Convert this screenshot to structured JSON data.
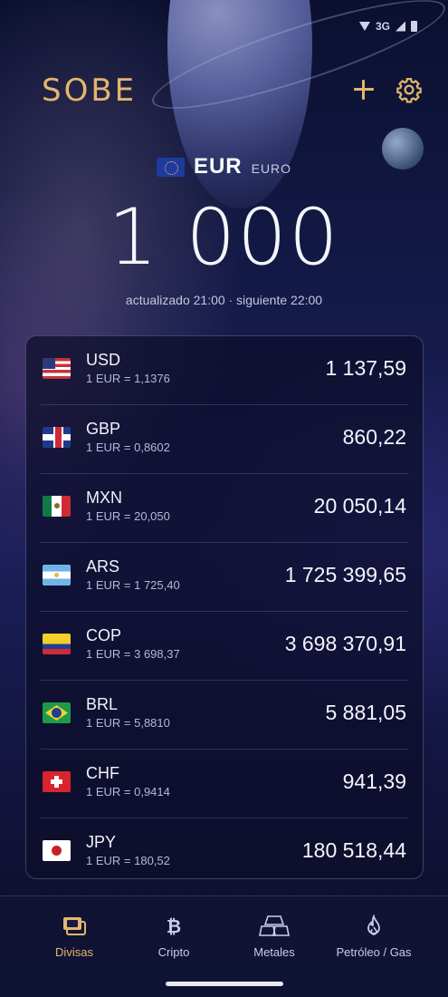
{
  "app": {
    "logo": "SOBE"
  },
  "header": {
    "add_icon": "plus-icon",
    "settings_icon": "gear-icon",
    "accent_color": "#e3b66c"
  },
  "status_bar": {
    "network": "3G"
  },
  "base_currency": {
    "flag": "eu-flag",
    "code": "EUR",
    "name": "EURO",
    "amount": "1 000",
    "updated": "actualizado 21:00 · siguiente 22:00"
  },
  "rates": [
    {
      "flag": "us-flag",
      "code": "USD",
      "rate": "1 EUR = 1,1376",
      "value": "1 137,59"
    },
    {
      "flag": "gb-flag",
      "code": "GBP",
      "rate": "1 EUR = 0,8602",
      "value": "860,22"
    },
    {
      "flag": "mx-flag",
      "code": "MXN",
      "rate": "1 EUR = 20,050",
      "value": "20 050,14"
    },
    {
      "flag": "ar-flag",
      "code": "ARS",
      "rate": "1 EUR = 1 725,40",
      "value": "1 725 399,65"
    },
    {
      "flag": "co-flag",
      "code": "COP",
      "rate": "1 EUR = 3 698,37",
      "value": "3 698 370,91"
    },
    {
      "flag": "br-flag",
      "code": "BRL",
      "rate": "1 EUR = 5,8810",
      "value": "5 881,05"
    },
    {
      "flag": "ch-flag",
      "code": "CHF",
      "rate": "1 EUR = 0,9414",
      "value": "941,39"
    },
    {
      "flag": "jp-flag",
      "code": "JPY",
      "rate": "1 EUR = 180,52",
      "value": "180 518,44"
    }
  ],
  "bottom_nav": {
    "items": [
      {
        "label": "Divisas",
        "icon": "banknotes-icon",
        "active": true
      },
      {
        "label": "Cripto",
        "icon": "bitcoin-icon",
        "active": false
      },
      {
        "label": "Metales",
        "icon": "gold-bars-icon",
        "active": false
      },
      {
        "label": "Petróleo / Gas",
        "icon": "flame-icon",
        "active": false
      }
    ]
  }
}
